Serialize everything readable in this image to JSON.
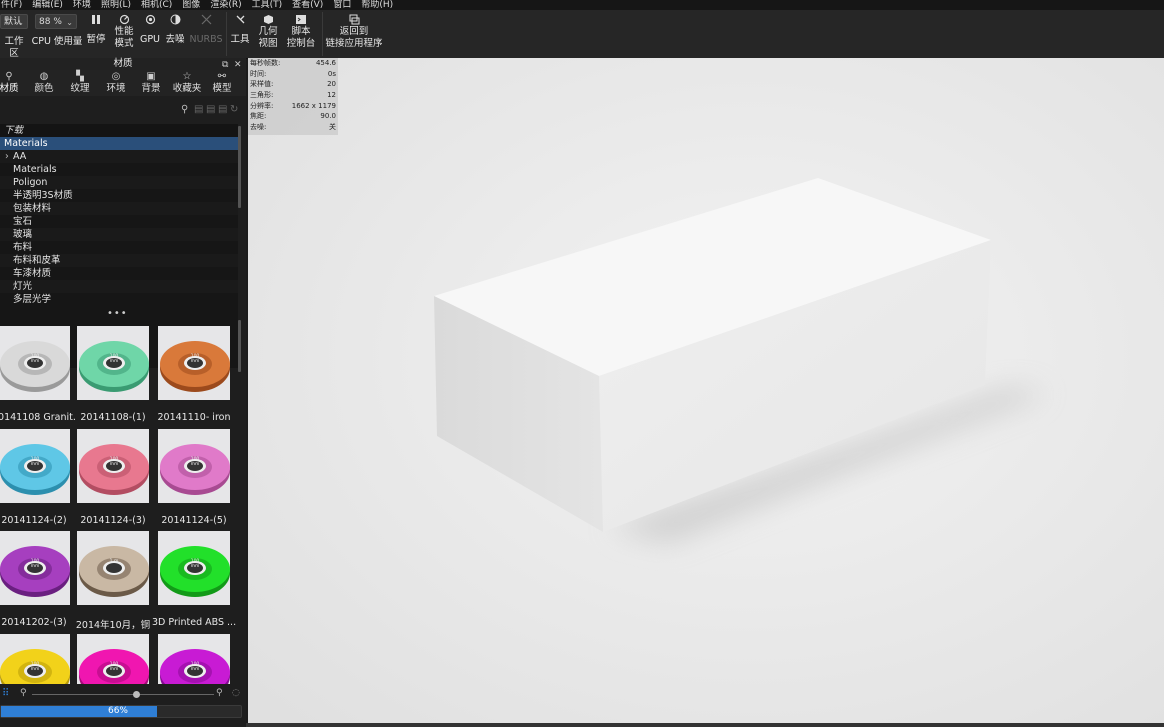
{
  "menu": [
    "件(F)",
    "编辑(E)",
    "环境",
    "照明(L)",
    "相机(C)",
    "图像",
    "渲染(R)",
    "工具(T)",
    "查看(V)",
    "窗口",
    "帮助(H)"
  ],
  "toolbar": {
    "workspace": {
      "value": "默认",
      "label": "工作区"
    },
    "cpu": {
      "value": "88 %",
      "label": "CPU 使用量"
    },
    "pause_label": "暂停",
    "perf_label": "性能\n模式",
    "gpu_label": "GPU",
    "denoise_label": "去噪",
    "nurbs_label": "NURBS",
    "tools_label": "工具",
    "geom_label": "几何\n视图",
    "script_label": "脚本\n控制台",
    "return_label": "返回到\n链接应用程序"
  },
  "panel": {
    "title": "材质",
    "tabs": [
      {
        "label": "材质",
        "icon": "material-icon"
      },
      {
        "label": "颜色",
        "icon": "palette-icon"
      },
      {
        "label": "纹理",
        "icon": "texture-icon"
      },
      {
        "label": "环境",
        "icon": "globe-icon"
      },
      {
        "label": "背景",
        "icon": "image-icon"
      },
      {
        "label": "收藏夹",
        "icon": "star-icon"
      },
      {
        "label": "模型",
        "icon": "models-icon"
      }
    ]
  },
  "tree": {
    "header": "下载",
    "items": [
      {
        "label": "Materials",
        "indent": 0,
        "selected": true,
        "arrow": false
      },
      {
        "label": "AA",
        "indent": 1,
        "selected": false,
        "arrow": true
      },
      {
        "label": "Materials",
        "indent": 1,
        "selected": false,
        "arrow": false
      },
      {
        "label": "Poligon",
        "indent": 1,
        "selected": false,
        "arrow": false
      },
      {
        "label": "半透明3S材质",
        "indent": 1,
        "selected": false,
        "arrow": false
      },
      {
        "label": "包装材料",
        "indent": 1,
        "selected": false,
        "arrow": false
      },
      {
        "label": "宝石",
        "indent": 1,
        "selected": false,
        "arrow": false
      },
      {
        "label": "玻璃",
        "indent": 1,
        "selected": false,
        "arrow": false
      },
      {
        "label": "布料",
        "indent": 1,
        "selected": false,
        "arrow": false
      },
      {
        "label": "布料和皮革",
        "indent": 1,
        "selected": false,
        "arrow": false
      },
      {
        "label": "车漆材质",
        "indent": 1,
        "selected": false,
        "arrow": false
      },
      {
        "label": "灯光",
        "indent": 1,
        "selected": false,
        "arrow": false
      },
      {
        "label": "多层光学",
        "indent": 1,
        "selected": false,
        "arrow": false
      }
    ]
  },
  "materials": [
    {
      "label": "20141108 Granit...",
      "color": "#d9d9d9",
      "dark": "#9a9a9a"
    },
    {
      "label": "20141108-(1)",
      "color": "#6fd6a8",
      "dark": "#3a9b72"
    },
    {
      "label": "20141110- iron",
      "color": "#d9793a",
      "dark": "#9c4a1c"
    },
    {
      "label": "20141124-(2)",
      "color": "#5fc7e6",
      "dark": "#2c8fae"
    },
    {
      "label": "20141124-(3)",
      "color": "#e8788f",
      "dark": "#b34d62"
    },
    {
      "label": "20141124-(5)",
      "color": "#e07ac9",
      "dark": "#a84a92"
    },
    {
      "label": "20141202-(3)",
      "color": "#a63fbf",
      "dark": "#6a1f80"
    },
    {
      "label": "2014年10月，铜",
      "color": "#c9b8a4",
      "dark": "#6b5a48"
    },
    {
      "label": "3D Printed ABS ...",
      "color": "#22e02a",
      "dark": "#129a18"
    },
    {
      "label": "",
      "color": "#f2d21a",
      "dark": "#b89a08"
    },
    {
      "label": "",
      "color": "#f016b0",
      "dark": "#a80a7a"
    },
    {
      "label": "",
      "color": "#c81bd4",
      "dark": "#880a94"
    }
  ],
  "thumb_text": "100\nmm",
  "thumb_text_alt": "1 m",
  "progress": {
    "value": 0.66,
    "text": "66%"
  },
  "stats": [
    {
      "k": "每秒帧数:",
      "v": "454.6"
    },
    {
      "k": "时间:",
      "v": "0s"
    },
    {
      "k": "采样值:",
      "v": "20"
    },
    {
      "k": "三角形:",
      "v": "12"
    },
    {
      "k": "分辨率:",
      "v": "1662 x 1179"
    },
    {
      "k": "焦距:",
      "v": "90.0"
    },
    {
      "k": "去噪:",
      "v": "关"
    }
  ],
  "colors": {
    "accent": "#2f7fd6",
    "selection": "#2a4f7a",
    "viewport_bg": "#ebebeb"
  }
}
